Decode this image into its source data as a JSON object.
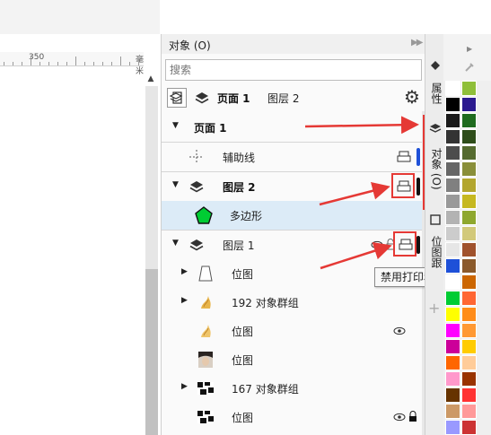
{
  "ruler": {
    "label": "350",
    "unit": "毫米"
  },
  "panel": {
    "title": "对象 (O)",
    "search_placeholder": "搜索",
    "toolbar": {
      "page": "页面 1",
      "layer": "图层 2"
    }
  },
  "tree": [
    {
      "label": "页面 1",
      "bold": true,
      "expanded": true
    },
    {
      "label": "辅助线",
      "bar_color": "#1e50d8"
    },
    {
      "label": "图层 2",
      "bold": true,
      "expanded": true,
      "bar_color": "#111111"
    },
    {
      "label": "多边形",
      "selected": true,
      "fill": "#00cc33"
    },
    {
      "label": "图层 1",
      "expanded": true,
      "bar_color": "#111111"
    },
    {
      "label": "位图"
    },
    {
      "label": "192 对象群组"
    },
    {
      "label": "位图"
    },
    {
      "label": "位图"
    },
    {
      "label": "167 对象群组"
    },
    {
      "label": "位图"
    }
  ],
  "tooltip": "禁用打印和导出(&D)",
  "tabs": {
    "properties": "属性",
    "objects": "对象 (O)",
    "bitmap": "位图跟"
  },
  "colors": {
    "highlight": "#e53935",
    "selection": "#dcebf7",
    "polygon": "#00cc33"
  }
}
